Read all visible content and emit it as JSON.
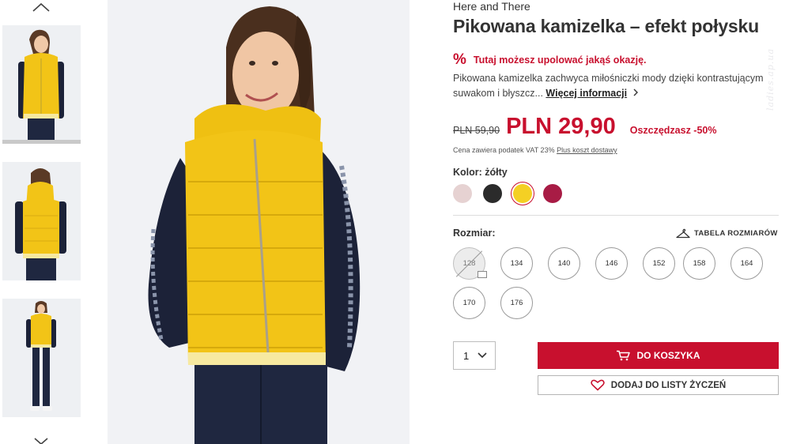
{
  "product": {
    "brand": "Here and There",
    "title": "Pikowana kamizelka – efekt połysku",
    "promo_icon": "%",
    "promo_text": "Tutaj możesz upolować jakąś okazję.",
    "description": "Pikowana kamizelka zachwyca miłośniczki mody dzięki kontrastującym suwakom i błyszcz...",
    "more_info_label": "Więcej informacji",
    "old_price": "PLN 59,90",
    "new_price": "PLN 29,90",
    "savings": "Oszczędzasz -50%",
    "vat_text": "Cena zawiera podatek VAT 23%",
    "shipping_link": "Plus koszt dostawy"
  },
  "color": {
    "label": "Kolor: żółty",
    "swatches": [
      {
        "name": "pink",
        "hex": "#e6d2d2",
        "selected": false
      },
      {
        "name": "black",
        "hex": "#2b2b2b",
        "selected": false
      },
      {
        "name": "yellow",
        "hex": "#f4d024",
        "selected": true
      },
      {
        "name": "burgundy",
        "hex": "#a81c45",
        "selected": false
      }
    ]
  },
  "size": {
    "label": "Rozmiar:",
    "table_label": "TABELA ROZMIARÓW",
    "options": [
      {
        "label": "128",
        "available": false
      },
      {
        "label": "134",
        "available": true
      },
      {
        "label": "140",
        "available": true
      },
      {
        "label": "146",
        "available": true
      },
      {
        "label": "152",
        "available": true
      },
      {
        "label": "158",
        "available": true
      },
      {
        "label": "164",
        "available": true
      },
      {
        "label": "170",
        "available": true
      },
      {
        "label": "176",
        "available": true
      }
    ]
  },
  "purchase": {
    "quantity": "1",
    "add_to_cart_label": "DO KOSZYKA",
    "wishlist_label": "DODAJ DO LISTY ŻYCZEŃ"
  },
  "watermark": "ladies.ap.ua",
  "colors": {
    "accent": "#c8102e",
    "vest_yellow": "#f2c417",
    "sleeve_navy": "#1c2238"
  },
  "icons": {
    "thumb_up": "chevron-up-icon",
    "thumb_down": "chevron-down-icon",
    "hanger": "hanger-icon",
    "cart": "cart-icon",
    "heart": "heart-icon",
    "qty_chevron": "chevron-down-icon"
  }
}
